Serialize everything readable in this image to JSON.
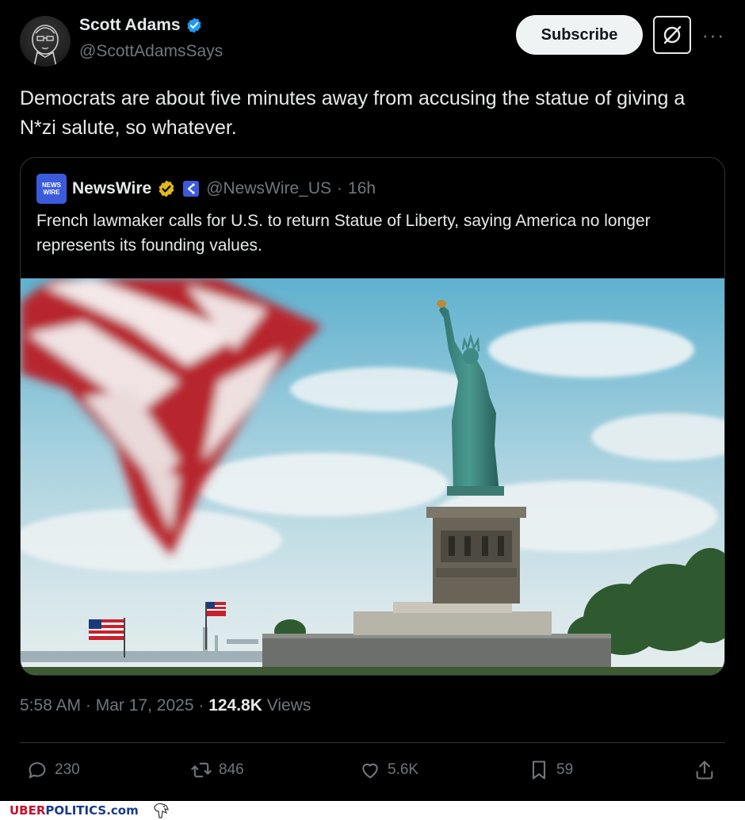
{
  "author": {
    "display_name": "Scott Adams",
    "handle": "@ScottAdamsSays",
    "verified_color": "#1d9bf0"
  },
  "header": {
    "subscribe_label": "Subscribe",
    "grok_icon": "grok-icon",
    "more_icon": "more-icon"
  },
  "post": {
    "text": "Democrats are about five minutes away from accusing the statue of giving a N*zi salute, so whatever."
  },
  "quoted": {
    "avatar_text_line1": "NEWS",
    "avatar_text_line2": "WIRE",
    "display_name": "NewsWire",
    "handle": "@NewsWire_US",
    "separator": "·",
    "time": "16h",
    "text": "French lawmaker calls for U.S. to return Statue of Liberty, saying America no longer represents its founding values.",
    "image_subject": "Statue of Liberty with blurred American flag in foreground"
  },
  "meta": {
    "time": "5:58 AM",
    "sep1": "·",
    "date": "Mar 17, 2025",
    "sep2": "·",
    "views_count": "124.8K",
    "views_label": "Views"
  },
  "actions": {
    "replies": "230",
    "reposts": "846",
    "likes": "5.6K",
    "bookmarks": "59"
  },
  "footer": {
    "uber": "UBER",
    "politics": "POLITICS.com"
  },
  "colors": {
    "background": "#000000",
    "text": "#e7e9ea",
    "muted": "#71767b",
    "border": "#2f3336",
    "brand_red": "#c8102e",
    "brand_blue": "#1a3a8c"
  }
}
